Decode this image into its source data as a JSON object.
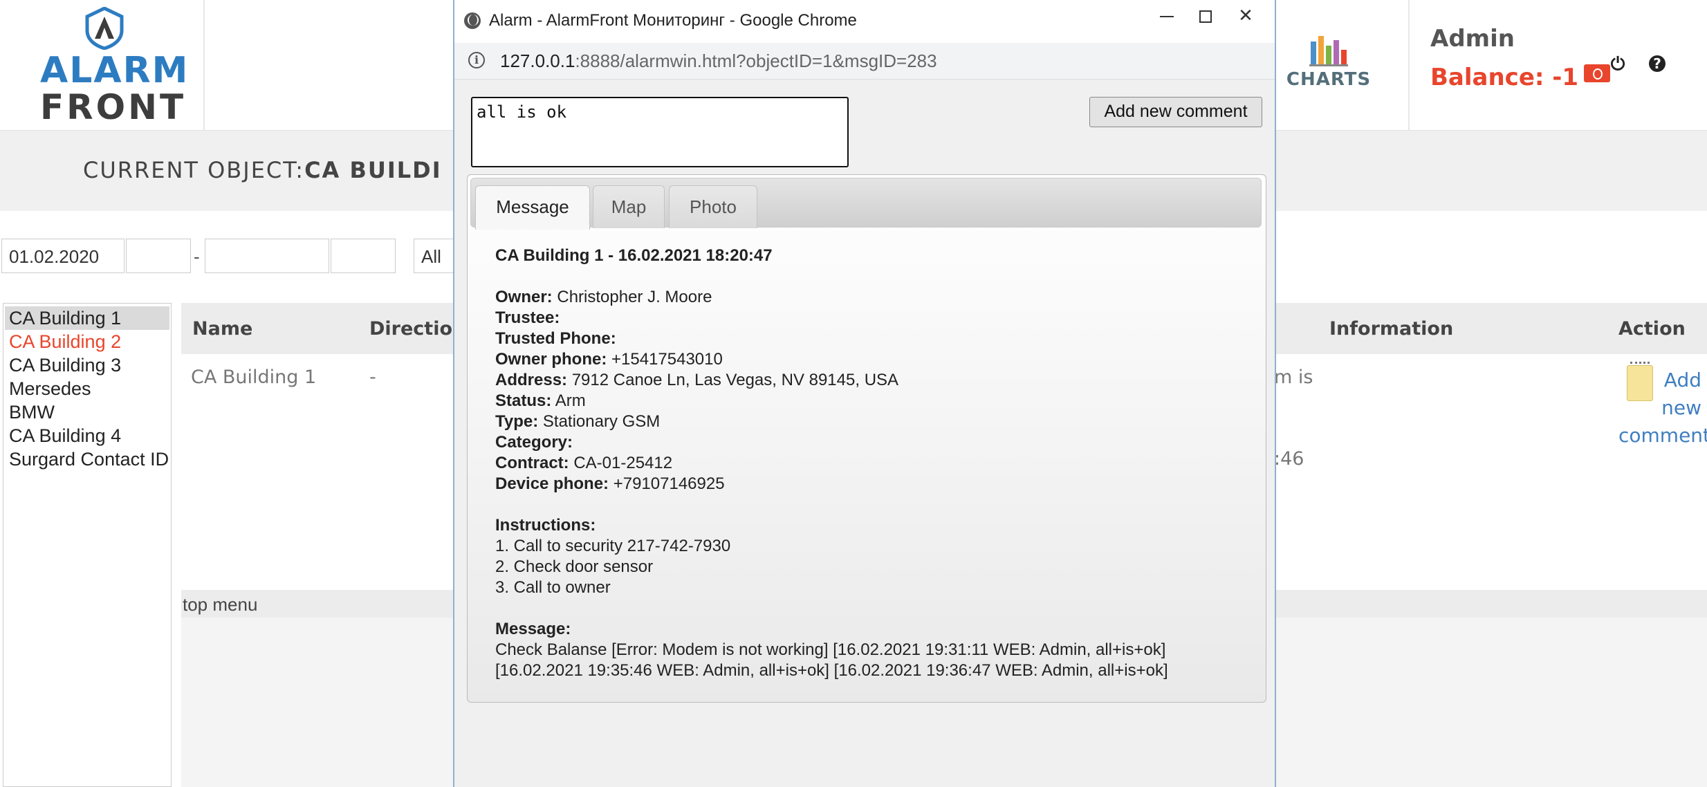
{
  "app": {
    "logo_line1": "ALARM",
    "logo_line2": "FRONT",
    "charts_label": "CHARTS",
    "user_name": "Admin",
    "balance": "Balance: -1",
    "power_icon": "power-icon",
    "help_icon": "help-icon",
    "accent": "#e8452c",
    "brand_blue": "#2d7cc1"
  },
  "object_bar": {
    "prefix": "CURRENT OBJECT:",
    "name": "CA BUILDI"
  },
  "filters": {
    "date_from": "01.02.2020",
    "time_from": "",
    "date_to": "",
    "time_to": "",
    "dash": "-",
    "type_select": "All"
  },
  "objects": [
    {
      "label": "CA Building 1"
    },
    {
      "label": "CA Building 2"
    },
    {
      "label": "CA Building 3"
    },
    {
      "label": "Mersedes"
    },
    {
      "label": "BMW"
    },
    {
      "label": "CA Building 4"
    },
    {
      "label": "Surgard Contact ID"
    }
  ],
  "table": {
    "headers": {
      "name": "Name",
      "direction": "Direction",
      "information": "Information",
      "action": "Action"
    },
    "row": {
      "name": "CA Building 1",
      "direction": "-",
      "info_fragment_1": "m is",
      "info_fragment_2": ":46",
      "action_label": "Add new comment"
    },
    "footer": "top menu"
  },
  "popup": {
    "window_title": "Alarm - AlarmFront Мониторинг - Google Chrome",
    "url_host": "127.0.0.1",
    "url_rest": ":8888/alarmwin.html?objectID=1&msgID=283",
    "minimize": "minimize-icon",
    "maximize": "maximize-icon",
    "close": "✕",
    "comment_value": "all is ok",
    "add_comment_label": "Add new comment",
    "tabs": [
      {
        "label": "Message",
        "active": true
      },
      {
        "label": "Map",
        "active": false
      },
      {
        "label": "Photo",
        "active": false
      }
    ],
    "message": {
      "heading": "CA Building 1 - 16.02.2021 18:20:47",
      "fields": [
        {
          "label": "Owner:",
          "value": " Christopher J. Moore"
        },
        {
          "label": "Trustee:",
          "value": ""
        },
        {
          "label": "Trusted Phone:",
          "value": ""
        },
        {
          "label": "Owner phone:",
          "value": " +15417543010"
        },
        {
          "label": "Address:",
          "value": " 7912 Canoe Ln, Las Vegas, NV 89145, USA"
        },
        {
          "label": "Status:",
          "value": " Arm"
        },
        {
          "label": "Type:",
          "value": " Stationary GSM"
        },
        {
          "label": "Category:",
          "value": ""
        },
        {
          "label": "Contract:",
          "value": " CA-01-25412"
        },
        {
          "label": "Device phone:",
          "value": " +79107146925"
        }
      ],
      "instructions_label": "Instructions:",
      "instructions": [
        "1. Call to security 217-742-7930",
        "2. Check door sensor",
        "3. Call to owner"
      ],
      "message_label": "Message:",
      "message_lines": [
        "Check Balanse [Error: Modem is not working] [16.02.2021 19:31:11 WEB: Admin, all+is+ok]",
        "[16.02.2021 19:35:46 WEB: Admin, all+is+ok] [16.02.2021 19:36:47 WEB: Admin, all+is+ok]"
      ]
    }
  }
}
